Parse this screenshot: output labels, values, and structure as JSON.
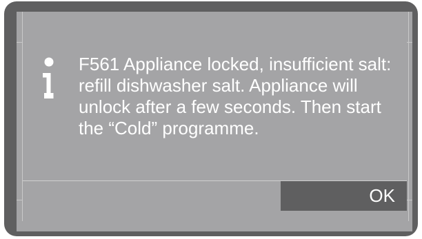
{
  "dialog": {
    "icon": "info-icon",
    "message": "F561 Appliance locked, insufficient salt:\nrefill dishwasher salt. Appliance will\nunlock after a few seconds. Then start\nthe “Cold” programme.",
    "ok_label": "OK"
  },
  "colors": {
    "bezel": "#5f5f60",
    "screen": "#a4a4a6",
    "text": "#ffffff",
    "button": "#5f5f60"
  }
}
